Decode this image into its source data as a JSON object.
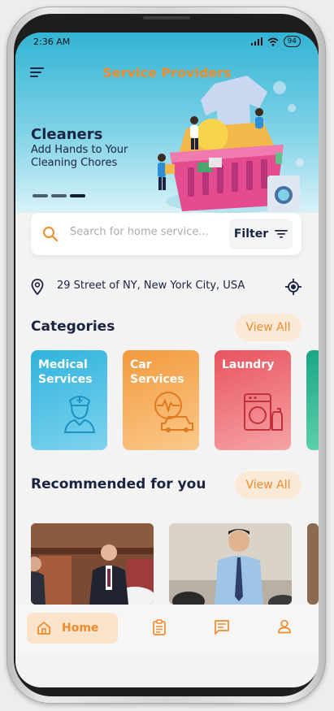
{
  "status": {
    "time": "2:36 AM",
    "battery": "94"
  },
  "header": {
    "title": "Service Providers"
  },
  "banner": {
    "title": "Cleaners",
    "subtitle": "Add Hands to Your Cleaning Chores"
  },
  "search": {
    "placeholder": "Search for home service...",
    "filter_label": "Filter"
  },
  "location": {
    "address": "29 Street of NY, New York City, USA"
  },
  "categories": {
    "title": "Categories",
    "view_all": "View All",
    "items": [
      {
        "label": "Medical Services",
        "icon": "nurse-icon",
        "color": "#34b6dd"
      },
      {
        "label": "Car Services",
        "icon": "car-service-icon",
        "color": "#f5a347"
      },
      {
        "label": "Laundry",
        "icon": "washing-machine-icon",
        "color": "#e9626e"
      }
    ]
  },
  "recommended": {
    "title": "Recommended for you",
    "view_all": "View All"
  },
  "tabbar": {
    "home_label": "Home",
    "accent": "#f08c2a"
  }
}
